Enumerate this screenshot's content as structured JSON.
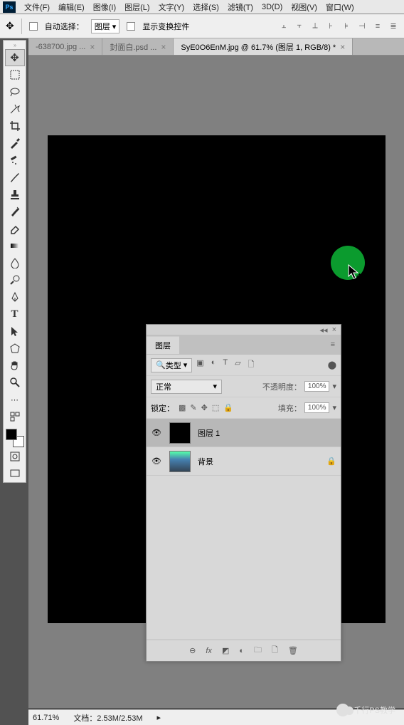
{
  "menu": {
    "items": [
      "文件(F)",
      "编辑(E)",
      "图像(I)",
      "图层(L)",
      "文字(Y)",
      "选择(S)",
      "滤镜(T)",
      "3D(D)",
      "视图(V)",
      "窗口(W)"
    ]
  },
  "options": {
    "auto_select": "自动选择：",
    "target": "图层",
    "show_transform": "显示变换控件"
  },
  "tabs": [
    {
      "label": "-638700.jpg ...",
      "active": false
    },
    {
      "label": "封面白.psd ...",
      "active": false
    },
    {
      "label": "SyE0O6EnM.jpg @ 61.7% (图层 1, RGB/8) *",
      "active": true
    }
  ],
  "layers_panel": {
    "title": "图层",
    "filter": "类型",
    "blend": "正常",
    "opacity_label": "不透明度：",
    "opacity": "100%",
    "lock_label": "锁定：",
    "fill_label": "填充：",
    "fill": "100%",
    "layers": [
      {
        "name": "图层 1",
        "selected": true,
        "locked": false
      },
      {
        "name": "背景",
        "selected": false,
        "locked": true
      }
    ]
  },
  "status": {
    "zoom": "61.71%",
    "doc": "文档：2.53M/2.53M"
  },
  "watermark": "千行PS教学"
}
